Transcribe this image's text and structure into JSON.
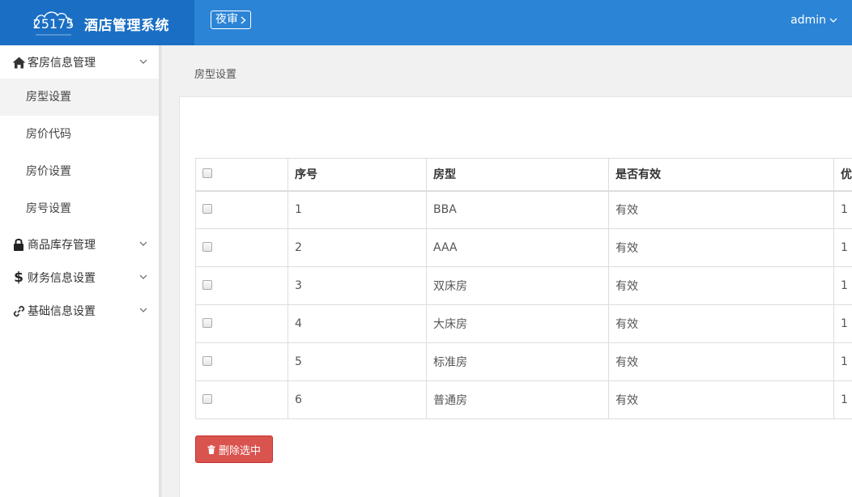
{
  "header": {
    "logo_text": "25175",
    "title": "酒店管理系统",
    "night_audit_label": "夜审",
    "user_name": "admin"
  },
  "sidebar": {
    "groups": [
      {
        "label": "客房信息管理",
        "icon": "home-icon",
        "items": [
          "房型设置",
          "房价代码",
          "房价设置",
          "房号设置"
        ],
        "active_item": "房型设置"
      },
      {
        "label": "商品库存管理",
        "icon": "lock-icon"
      },
      {
        "label": "财务信息设置",
        "icon": "dollar-icon"
      },
      {
        "label": "基础信息设置",
        "icon": "link-icon"
      }
    ]
  },
  "main": {
    "breadcrumb": "房型设置",
    "table": {
      "columns": [
        "序号",
        "房型",
        "是否有效",
        "优"
      ],
      "rows": [
        [
          "1",
          "BBA",
          "有效",
          "1"
        ],
        [
          "2",
          "AAA",
          "有效",
          "1"
        ],
        [
          "3",
          "双床房",
          "有效",
          "1"
        ],
        [
          "4",
          "大床房",
          "有效",
          "1"
        ],
        [
          "5",
          "标准房",
          "有效",
          "1"
        ],
        [
          "6",
          "普通房",
          "有效",
          "1"
        ]
      ]
    },
    "delete_button_label": "删除选中"
  },
  "colors": {
    "header": "#2b84d6",
    "brand": "#1a6fc4",
    "danger": "#d9534f"
  }
}
